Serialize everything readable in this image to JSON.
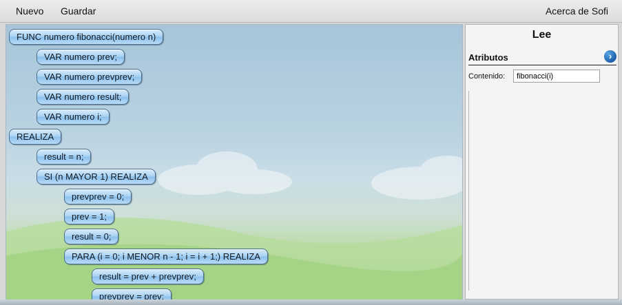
{
  "menubar": {
    "nuevo": "Nuevo",
    "guardar": "Guardar",
    "acerca": "Acerca de Sofi"
  },
  "blocks": [
    {
      "text": "FUNC numero fibonacci(numero n)",
      "indent": 0
    },
    {
      "text": "VAR numero prev;",
      "indent": 1
    },
    {
      "text": "VAR numero prevprev;",
      "indent": 1
    },
    {
      "text": "VAR numero result;",
      "indent": 1
    },
    {
      "text": "VAR numero i;",
      "indent": 1
    },
    {
      "text": "REALIZA",
      "indent": 0
    },
    {
      "text": "result = n;",
      "indent": 1
    },
    {
      "text": "SI (n MAYOR 1) REALIZA",
      "indent": 1
    },
    {
      "text": "prevprev = 0;",
      "indent": 2
    },
    {
      "text": "prev = 1;",
      "indent": 2
    },
    {
      "text": "result = 0;",
      "indent": 2
    },
    {
      "text": "PARA (i = 0; i MENOR n - 1; i = i + 1;) REALIZA",
      "indent": 2
    },
    {
      "text": "result = prev + prevprev;",
      "indent": 3
    },
    {
      "text": "prevprev = prev;",
      "indent": 3
    }
  ],
  "panel": {
    "title": "Lee",
    "attributes_label": "Atributos",
    "toggle_icon": "chevron-right-icon",
    "contenido_label": "Contenido:",
    "contenido_value": "fibonacci(i)"
  },
  "colors": {
    "block_fill": "#a9d2f3",
    "block_border": "#4a6e8e",
    "toggle": "#1b5fa8"
  }
}
